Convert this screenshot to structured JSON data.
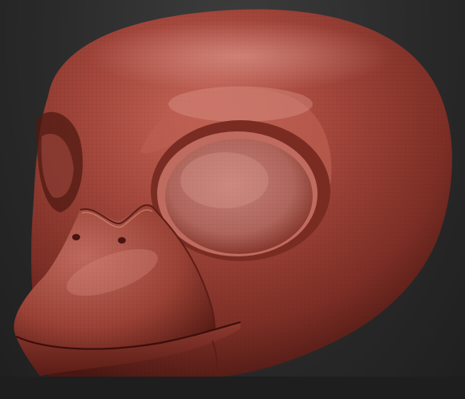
{
  "scene": {
    "background_color": "#2b2b2b",
    "material_color": "#a8493e",
    "highlight_color": "#d98c80",
    "shadow_color": "#4a1712",
    "subject": "sculpted-bird-head-mesh"
  }
}
